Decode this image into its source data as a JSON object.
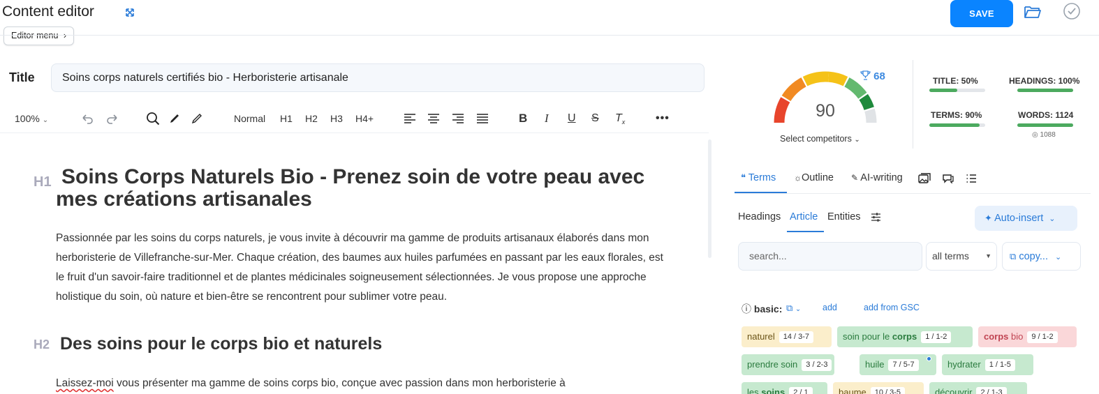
{
  "header": {
    "title": "Content editor",
    "editor_menu": "Editor menu",
    "save": "SAVE"
  },
  "title_field": {
    "label": "Title",
    "value": "Soins corps naturels certifiés bio - Herboristerie artisanale"
  },
  "toolbar": {
    "zoom": "100%",
    "normal": "Normal",
    "h1": "H1",
    "h2": "H2",
    "h3": "H3",
    "h4": "H4+"
  },
  "document": {
    "h1_tag": "H1",
    "h1": "Soins Corps Naturels Bio - Prenez soin de votre peau avec mes créations artisanales",
    "p1": "Passionnée par les soins du corps naturels, je vous invite à découvrir ma gamme de produits artisanaux élaborés dans mon herboristerie de Villefranche-sur-Mer. Chaque création, des baumes aux huiles parfumées en passant par les eaux florales, est le fruit d'un savoir-faire traditionnel et de plantes médicinales soigneusement sélectionnées. Je vous propose une approche holistique du soin, où nature et bien-être se rencontrent pour sublimer votre peau.",
    "h2_tag": "H2",
    "h2": "Des soins pour le corps bio et naturels",
    "p2_first": "Laissez-moi",
    "p2_rest": " vous présenter ma gamme de soins corps bio, conçue avec passion dans mon herboristerie à"
  },
  "score": {
    "value": "90",
    "gauge_level": 0.9,
    "top_competitor": "68",
    "select_competitors": "Select competitors"
  },
  "metrics": [
    {
      "label": "TITLE: 50%",
      "fill": 0.5
    },
    {
      "label": "HEADINGS: 100%",
      "fill": 1.0
    },
    {
      "label": "TERMS: 90%",
      "fill": 0.9
    },
    {
      "label": "WORDS: 1124",
      "fill": 1.0,
      "sub": "1088"
    }
  ],
  "panel_tabs": {
    "terms": "Terms",
    "outline": "Outline",
    "ai_writing": "AI-writing"
  },
  "sub_tabs": {
    "headings": "Headings",
    "article": "Article",
    "entities": "Entities",
    "auto_insert": "Auto-insert"
  },
  "filters": {
    "search_placeholder": "search...",
    "all_terms": "all terms",
    "copy": "copy..."
  },
  "terms_section": {
    "label": "basic:",
    "add": "add",
    "add_gsc": "add from GSC"
  },
  "chips": [
    {
      "pre": "naturel",
      "bold": "",
      "post": "",
      "count": "14 / 3-7",
      "color": "yellow"
    },
    {
      "pre": "soin pour le ",
      "bold": "corps",
      "post": "",
      "count": "1 / 1-2",
      "color": "green"
    },
    {
      "pre": "",
      "bold": "corps",
      "post": " bio",
      "count": "9 / 1-2",
      "color": "red"
    },
    {
      "pre": "prendre soin",
      "bold": "",
      "post": "",
      "count": "3 / 2-3",
      "color": "green"
    },
    {
      "pre": "huile",
      "bold": "",
      "post": "",
      "count": "7 / 5-7",
      "color": "green"
    },
    {
      "pre": "hydrater",
      "bold": "",
      "post": "",
      "count": "1 / 1-5",
      "color": "green"
    },
    {
      "pre": "les ",
      "bold": "soins",
      "post": "",
      "count": "2 / 1",
      "color": "green"
    },
    {
      "pre": "baume",
      "bold": "",
      "post": "",
      "count": "10 / 3-5",
      "color": "yellow"
    },
    {
      "pre": "découvrir",
      "bold": "",
      "post": "",
      "count": "2 / 1-3",
      "color": "green"
    }
  ],
  "colors": {
    "accent": "#0a84ff",
    "link": "#2a7bd8",
    "chip_green": "#c6e9cf",
    "chip_yellow": "#fbeecb",
    "chip_red": "#fad7d9"
  }
}
